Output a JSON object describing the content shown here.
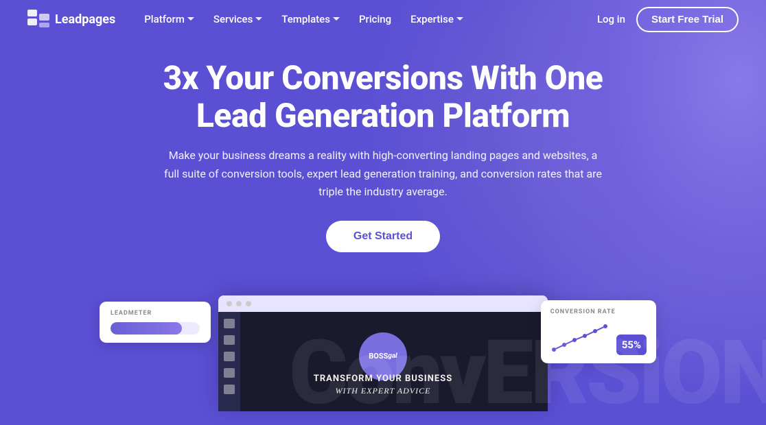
{
  "brand": {
    "name": "Leadpages",
    "logo_alt": "Leadpages logo"
  },
  "navbar": {
    "links": [
      {
        "label": "Platform",
        "has_dropdown": true
      },
      {
        "label": "Services",
        "has_dropdown": true
      },
      {
        "label": "Templates",
        "has_dropdown": true
      },
      {
        "label": "Pricing",
        "has_dropdown": false
      },
      {
        "label": "Expertise",
        "has_dropdown": true
      }
    ],
    "login_label": "Log in",
    "trial_label": "Start Free Trial"
  },
  "hero": {
    "title": "3x Your Conversions With One Lead Generation Platform",
    "subtitle": "Make your business dreams a reality with high-converting landing pages and websites, a full suite of conversion tools, expert lead generation training, and conversion rates that are triple the industry average.",
    "cta_label": "Get Started"
  },
  "leadmeter_card": {
    "label": "LEADMETER"
  },
  "conversion_card": {
    "label": "CONVERSION RATE",
    "percent": "55%"
  },
  "browser_inner": {
    "logo_line1": "BOSS",
    "logo_line2": "gal",
    "headline_line1": "TRANSFORM YOUR BUSINESS",
    "headline_line2": "with EXPERT ADVICE"
  },
  "bg_text": "ConvERSiON",
  "colors": {
    "primary_purple": "#5b4fd4",
    "light_purple": "#7b6fe0",
    "white": "#ffffff"
  }
}
